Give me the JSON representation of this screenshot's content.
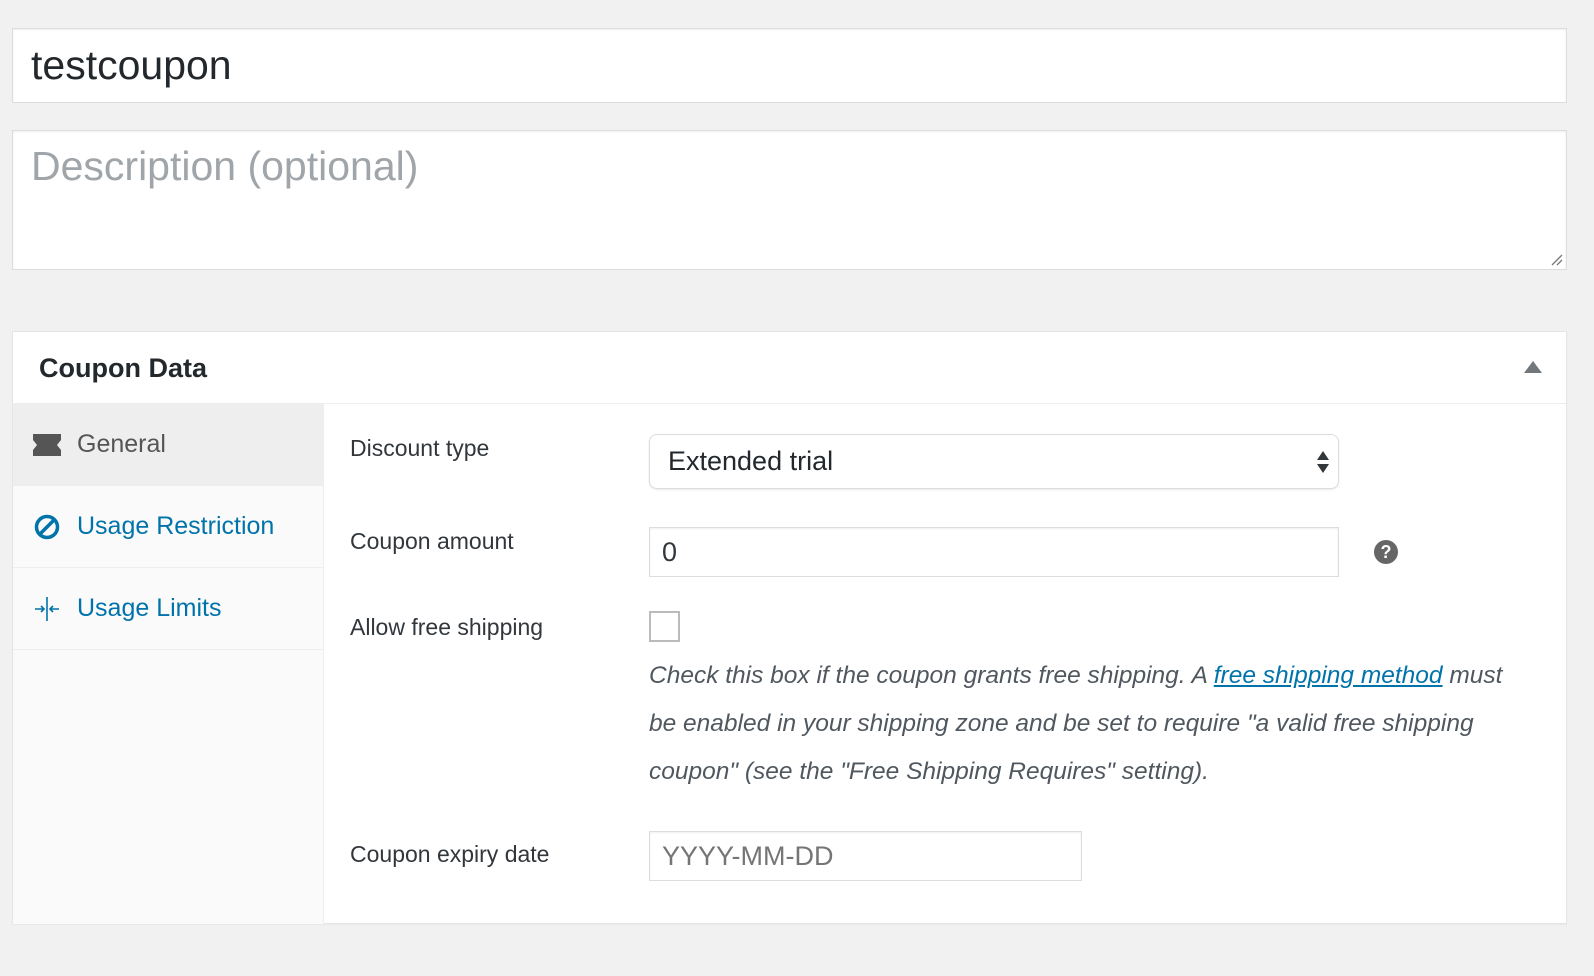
{
  "title_input": {
    "value": "testcoupon"
  },
  "description": {
    "placeholder": "Description (optional)"
  },
  "panel": {
    "title": "Coupon Data",
    "tabs": [
      {
        "label": "General",
        "icon": "ticket-icon",
        "active": true
      },
      {
        "label": "Usage Restriction",
        "icon": "no-entry-icon"
      },
      {
        "label": "Usage Limits",
        "icon": "limits-arrows-icon"
      }
    ],
    "fields": {
      "discount_type": {
        "label": "Discount type",
        "value": "Extended trial"
      },
      "coupon_amount": {
        "label": "Coupon amount",
        "value": "0",
        "help": "?"
      },
      "free_shipping": {
        "label": "Allow free shipping",
        "checked": false,
        "note_before": "Check this box if the coupon grants free shipping. A ",
        "note_link": "free shipping method",
        "note_after": " must be enabled in your shipping zone and be set to require \"a valid free shipping coupon\" (see the \"Free Shipping Requires\" setting)."
      },
      "expiry": {
        "label": "Coupon expiry date",
        "placeholder": "YYYY-MM-DD"
      }
    }
  },
  "colors": {
    "link": "#0073aa",
    "background": "#f1f1f1"
  }
}
